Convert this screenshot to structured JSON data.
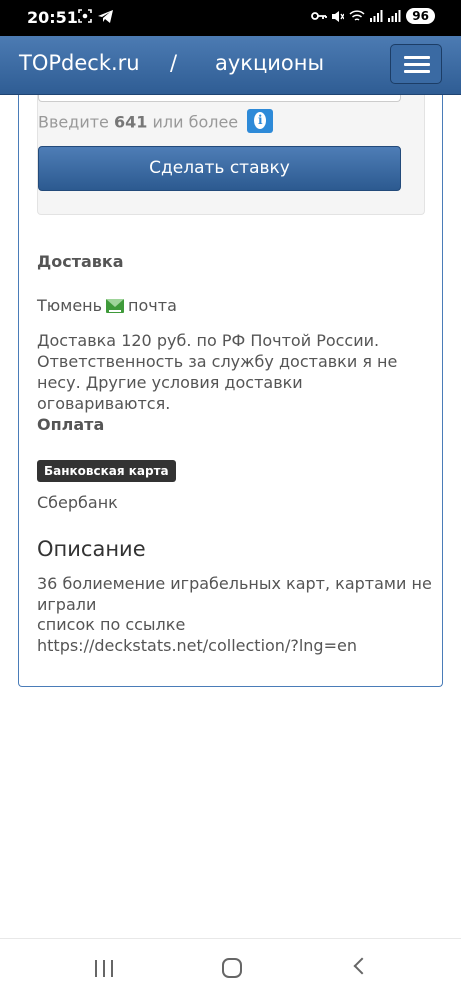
{
  "status_bar": {
    "time": "20:51",
    "battery": "96",
    "icons": [
      "screenshot-icon",
      "telegram-icon",
      "key-icon",
      "mute-icon",
      "wifi-icon",
      "signal-icon",
      "signal-icon"
    ]
  },
  "navbar": {
    "brand": "TOPdeck.ru",
    "separator": "/",
    "section": "аукционы",
    "menu_icon": "hamburger-menu-icon"
  },
  "bid": {
    "hint_prefix": "Введите",
    "min_bid": "641",
    "hint_suffix": "или более",
    "info_icon": "info-icon",
    "button_label": "Сделать ставку"
  },
  "delivery": {
    "heading": "Доставка",
    "city": "Тюмень",
    "mail_icon": "envelope-icon",
    "method": "почта",
    "text": "Доставка 120 руб. по РФ Почтой России. Ответственность за службу доставки я не несу. Другие условия доставки оговариваются."
  },
  "payment": {
    "heading": "Оплата",
    "badge": "Банковская карта",
    "bank": "Сбербанк"
  },
  "description": {
    "heading": "Описание",
    "lines": [
      "36 болиемение играбельных карт, картами не играли",
      "список по ссылке",
      "https://deckstats.net/collection/?lng=en"
    ]
  },
  "colors": {
    "navbar": "#3a6aa3",
    "button": "#3d6ca5",
    "info": "#2e8ad8",
    "badge": "#333333"
  }
}
